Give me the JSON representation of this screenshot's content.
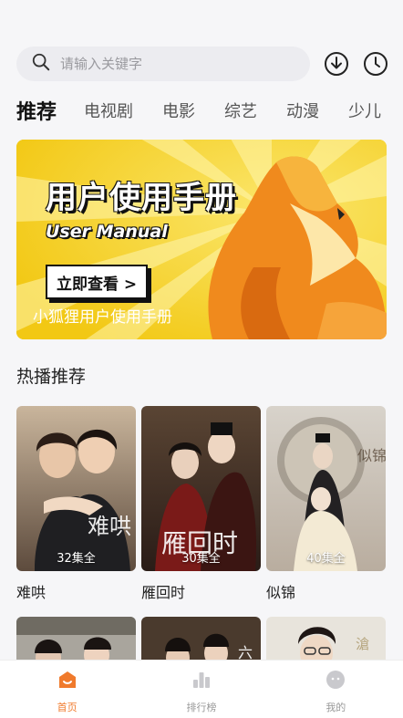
{
  "search": {
    "placeholder": "请输入关键字"
  },
  "header_icons": [
    "download-icon",
    "history-icon"
  ],
  "tabs": [
    {
      "label": "推荐",
      "active": true
    },
    {
      "label": "电视剧"
    },
    {
      "label": "电影"
    },
    {
      "label": "综艺"
    },
    {
      "label": "动漫"
    },
    {
      "label": "少儿"
    }
  ],
  "banner": {
    "title": "用户使用手册",
    "subtitle": "User Manual",
    "button": "立即查看 >",
    "caption": "小狐狸用户使用手册"
  },
  "section": {
    "title": "热播推荐"
  },
  "cards": [
    {
      "name": "难哄",
      "episodes": "32集全"
    },
    {
      "name": "雁回时",
      "episodes": "30集全"
    },
    {
      "name": "似锦",
      "episodes": "40集全"
    }
  ],
  "nav": [
    {
      "label": "首页",
      "icon": "home-icon",
      "active": true
    },
    {
      "label": "排行榜",
      "icon": "ranking-icon"
    },
    {
      "label": "我的",
      "icon": "profile-icon"
    }
  ],
  "colors": {
    "accent": "#f07a2c",
    "banner_bg": "#f4d21c"
  }
}
